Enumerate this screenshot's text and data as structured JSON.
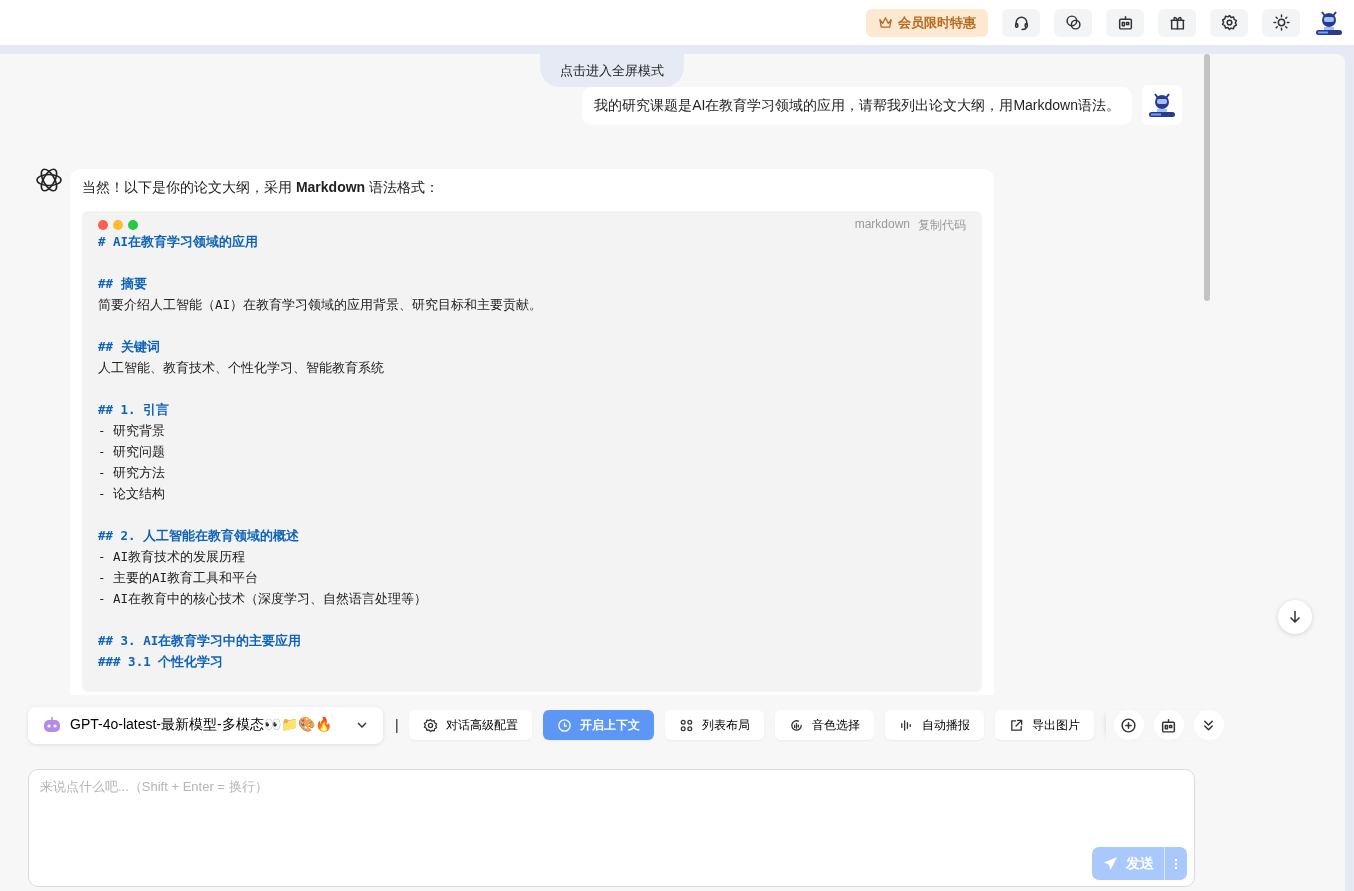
{
  "header": {
    "vip_button": "会员限时特惠",
    "icon_buttons": [
      {
        "kind": "headset"
      },
      {
        "kind": "chat"
      },
      {
        "kind": "robot"
      },
      {
        "kind": "gift"
      },
      {
        "kind": "settings"
      },
      {
        "kind": "sun"
      }
    ]
  },
  "chat": {
    "fullscreen_tab": "点击进入全屏模式",
    "user_message": "我的研究课题是AI在教育学习领域的应用，请帮我列出论文大纲，用Markdown语法。",
    "assistant_message": {
      "intro": "当然！以下是你的论文大纲，采用 **Markdown** 语法格式：",
      "code_block": {
        "language": "markdown",
        "copy_label": "复制代码",
        "lines": [
          {
            "kind": "heading",
            "text": "# AI在教育学习领域的应用"
          },
          {
            "kind": "blank"
          },
          {
            "kind": "heading",
            "text": "## 摘要"
          },
          {
            "kind": "text",
            "text": "简要介绍人工智能（AI）在教育学习领域的应用背景、研究目标和主要贡献。"
          },
          {
            "kind": "blank"
          },
          {
            "kind": "heading",
            "text": "## 关键词"
          },
          {
            "kind": "text",
            "text": "人工智能、教育技术、个性化学习、智能教育系统"
          },
          {
            "kind": "blank"
          },
          {
            "kind": "heading",
            "text": "## 1. 引言"
          },
          {
            "kind": "text",
            "text": "- 研究背景"
          },
          {
            "kind": "text",
            "text": "- 研究问题"
          },
          {
            "kind": "text",
            "text": "- 研究方法"
          },
          {
            "kind": "text",
            "text": "- 论文结构"
          },
          {
            "kind": "blank"
          },
          {
            "kind": "heading",
            "text": "## 2. 人工智能在教育领域的概述"
          },
          {
            "kind": "text",
            "text": "- AI教育技术的发展历程"
          },
          {
            "kind": "text",
            "text": "- 主要的AI教育工具和平台"
          },
          {
            "kind": "text",
            "text": "- AI在教育中的核心技术（深度学习、自然语言处理等）"
          },
          {
            "kind": "blank"
          },
          {
            "kind": "heading",
            "text": "## 3. AI在教育学习中的主要应用"
          },
          {
            "kind": "heading",
            "text": "### 3.1 个性化学习"
          }
        ]
      }
    }
  },
  "toolbar": {
    "model": "GPT-4o-latest-最新模型-多模态👀📁🎨🔥",
    "separator": "|",
    "buttons": [
      {
        "kind": "settings",
        "label": "对话高级配置",
        "selected": false
      },
      {
        "kind": "clock",
        "label": "开启上下文",
        "selected": true
      },
      {
        "kind": "grid",
        "label": "列表布局",
        "selected": false
      },
      {
        "kind": "voice",
        "label": "音色选择",
        "selected": false
      },
      {
        "kind": "wave",
        "label": "自动播报",
        "selected": false
      },
      {
        "kind": "export",
        "label": "导出图片",
        "selected": false
      }
    ],
    "round_buttons": [
      {
        "kind": "new-chat"
      },
      {
        "kind": "robot"
      },
      {
        "kind": "collapse"
      }
    ]
  },
  "composer": {
    "placeholder": "来说点什么吧...（Shift + Enter = 换行）",
    "send_button": "发送",
    "send_disabled": true
  }
}
